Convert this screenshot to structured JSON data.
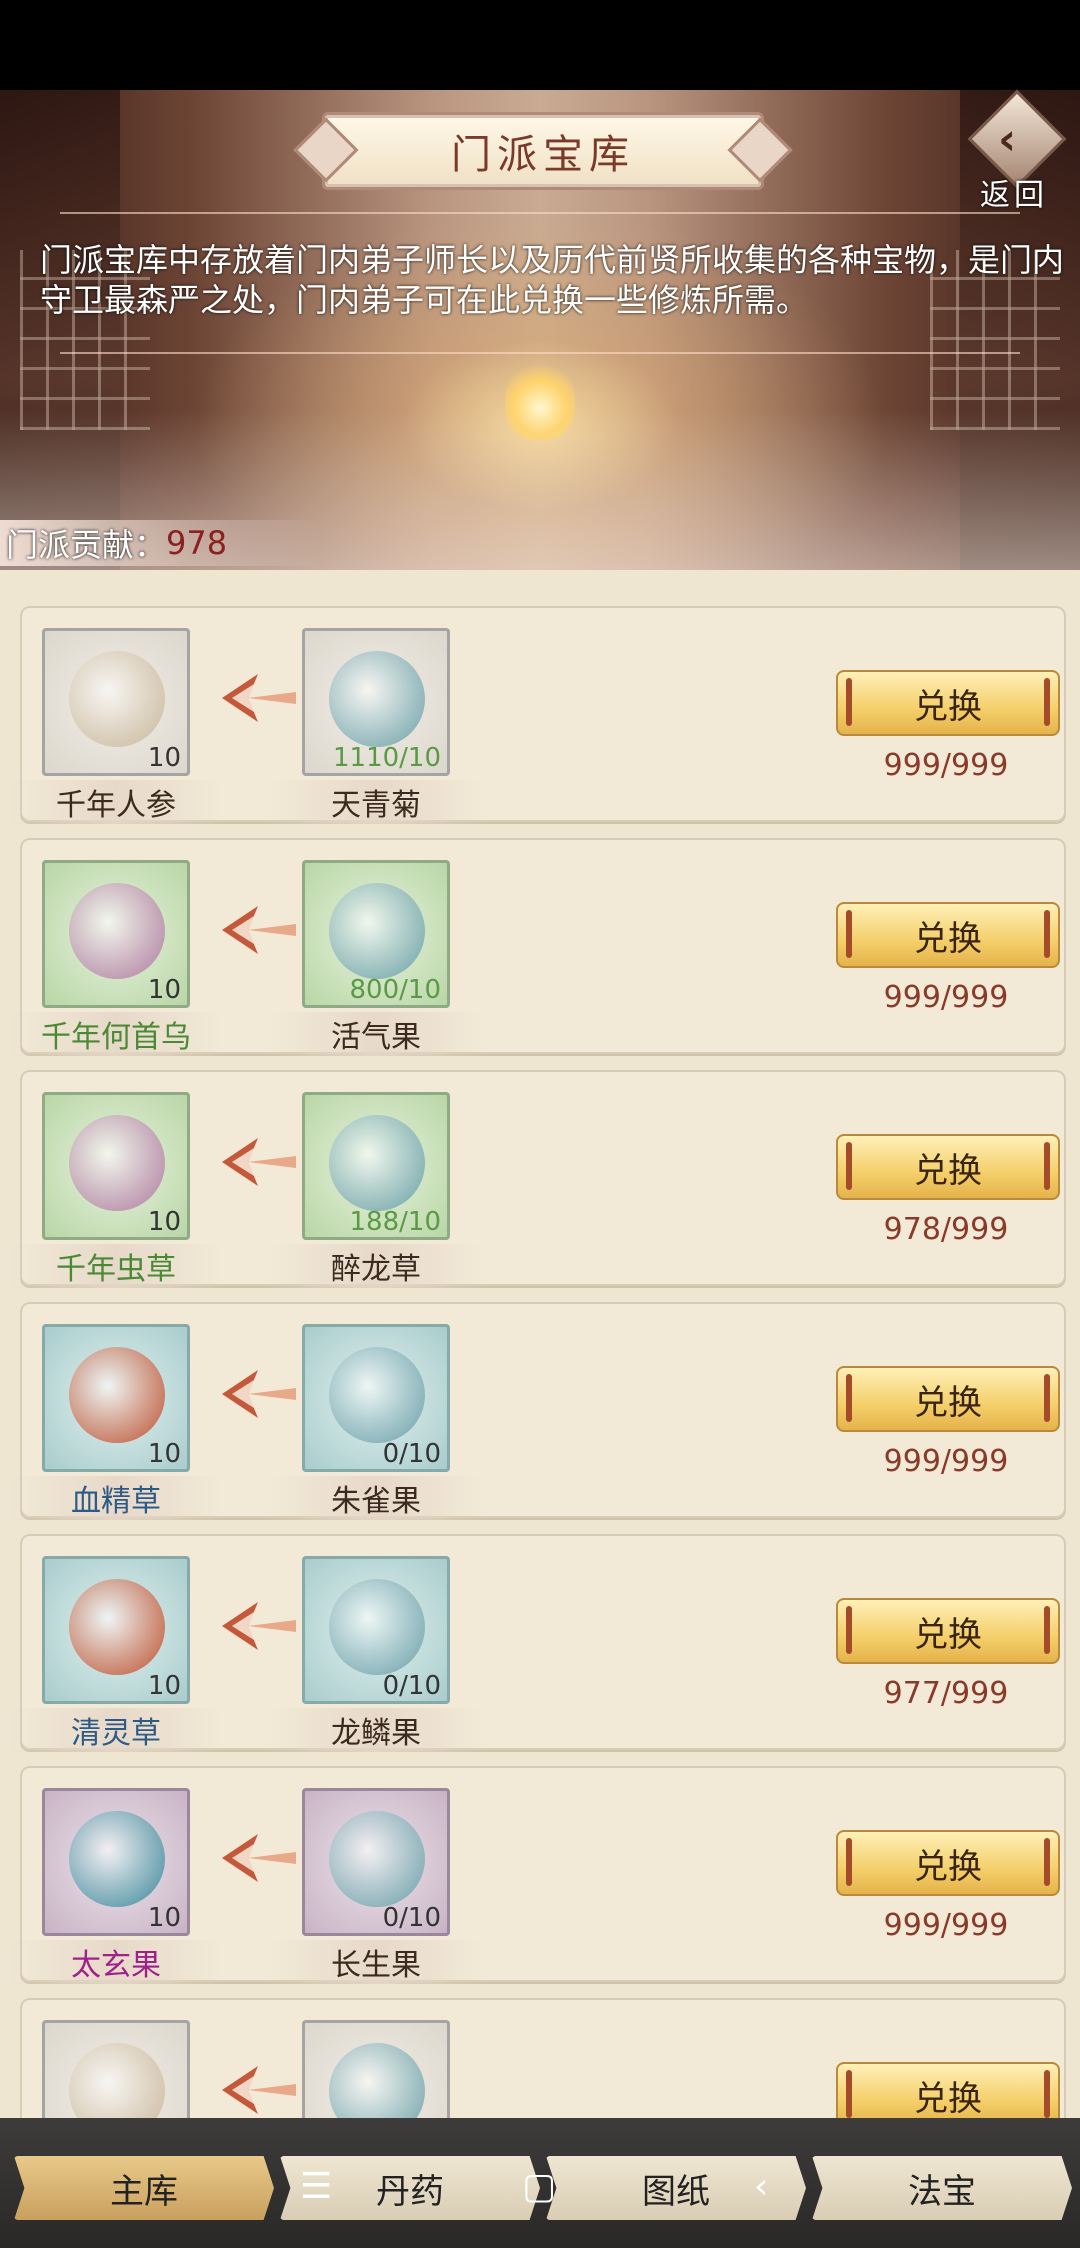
{
  "header": {
    "title": "门派宝库",
    "back_label": "返回",
    "description": "门派宝库中存放着门内弟子师长以及历代前贤所收集的各种宝物，是门内守卫最森严之处，门内弟子可在此兑换一些修炼所需。",
    "contribution_label": "门派贡献：",
    "contribution_value": "978"
  },
  "items": [
    {
      "reward_name": "千年人参",
      "reward_qty": "10",
      "reward_color": "grey",
      "cost_name": "天青菊",
      "cost_qty": "1110/10",
      "cost_color": "grey",
      "button": "兑换",
      "limit": "999/999"
    },
    {
      "reward_name": "千年何首乌",
      "reward_qty": "10",
      "reward_color": "green",
      "cost_name": "活气果",
      "cost_qty": "800/10",
      "cost_color": "green",
      "button": "兑换",
      "limit": "999/999"
    },
    {
      "reward_name": "千年虫草",
      "reward_qty": "10",
      "reward_color": "green",
      "cost_name": "醉龙草",
      "cost_qty": "188/10",
      "cost_color": "green",
      "button": "兑换",
      "limit": "978/999"
    },
    {
      "reward_name": "血精草",
      "reward_qty": "10",
      "reward_color": "teal",
      "cost_name": "朱雀果",
      "cost_qty": "0/10",
      "cost_color": "teal",
      "button": "兑换",
      "limit": "999/999"
    },
    {
      "reward_name": "清灵草",
      "reward_qty": "10",
      "reward_color": "teal",
      "cost_name": "龙鳞果",
      "cost_qty": "0/10",
      "cost_color": "teal",
      "button": "兑换",
      "limit": "977/999"
    },
    {
      "reward_name": "太玄果",
      "reward_qty": "10",
      "reward_color": "purple",
      "cost_name": "长生果",
      "cost_qty": "0/10",
      "cost_color": "purple",
      "button": "兑换",
      "limit": "999/999"
    },
    {
      "reward_name": "",
      "reward_qty": "",
      "reward_color": "grey",
      "cost_name": "",
      "cost_qty": "",
      "cost_color": "grey",
      "button": "兑换",
      "limit": ""
    }
  ],
  "tabs": [
    {
      "label": "主库",
      "active": true
    },
    {
      "label": "丹药",
      "active": false
    },
    {
      "label": "图纸",
      "active": false
    },
    {
      "label": "法宝",
      "active": false
    }
  ],
  "colors": {
    "accent_gold": "#f4cf6a",
    "limit_text": "#8a3a2a",
    "name_green": "#4a8a35",
    "name_blue": "#2e5b86",
    "name_magenta": "#a0208a"
  }
}
